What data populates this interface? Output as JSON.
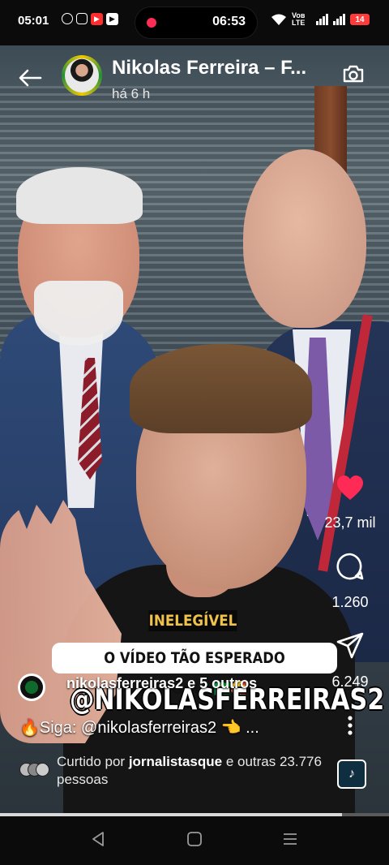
{
  "status_bar": {
    "time": "05:01",
    "recording_time": "06:53",
    "network": "Voʙ LTE",
    "battery": "14"
  },
  "header": {
    "owner_name": "Nikolas Ferreira – F...",
    "time_ago": "há 6 h"
  },
  "actions": {
    "likes": "23,7 mil",
    "comments": "1.260",
    "shares": "6.249",
    "like_color": "#ff2a55"
  },
  "video_text": {
    "ineligible_label": "INELEGÍVEL",
    "caption": "O VÍDEO TÃO ESPERADO CHEGOU. 🇧🇷🥰",
    "handle": "@NIKOLASFERREIRAS2"
  },
  "post": {
    "collaborators": "nikolasferreiras2 e 5 outros",
    "follow_text": "🔥Siga: @nikolasferreiras2 👈 ...",
    "liked_by_prefix": "Curtido por ",
    "liked_by_user": "jornalistasque",
    "liked_by_suffix": " e outras 23.776 pessoas"
  },
  "progress_fraction": 0.88,
  "icons": [
    "back-arrow-icon",
    "camera-icon",
    "heart-icon",
    "comment-icon",
    "share-icon",
    "more-icon",
    "music-icon",
    "recent-apps-icon",
    "home-icon",
    "back-nav-icon"
  ]
}
